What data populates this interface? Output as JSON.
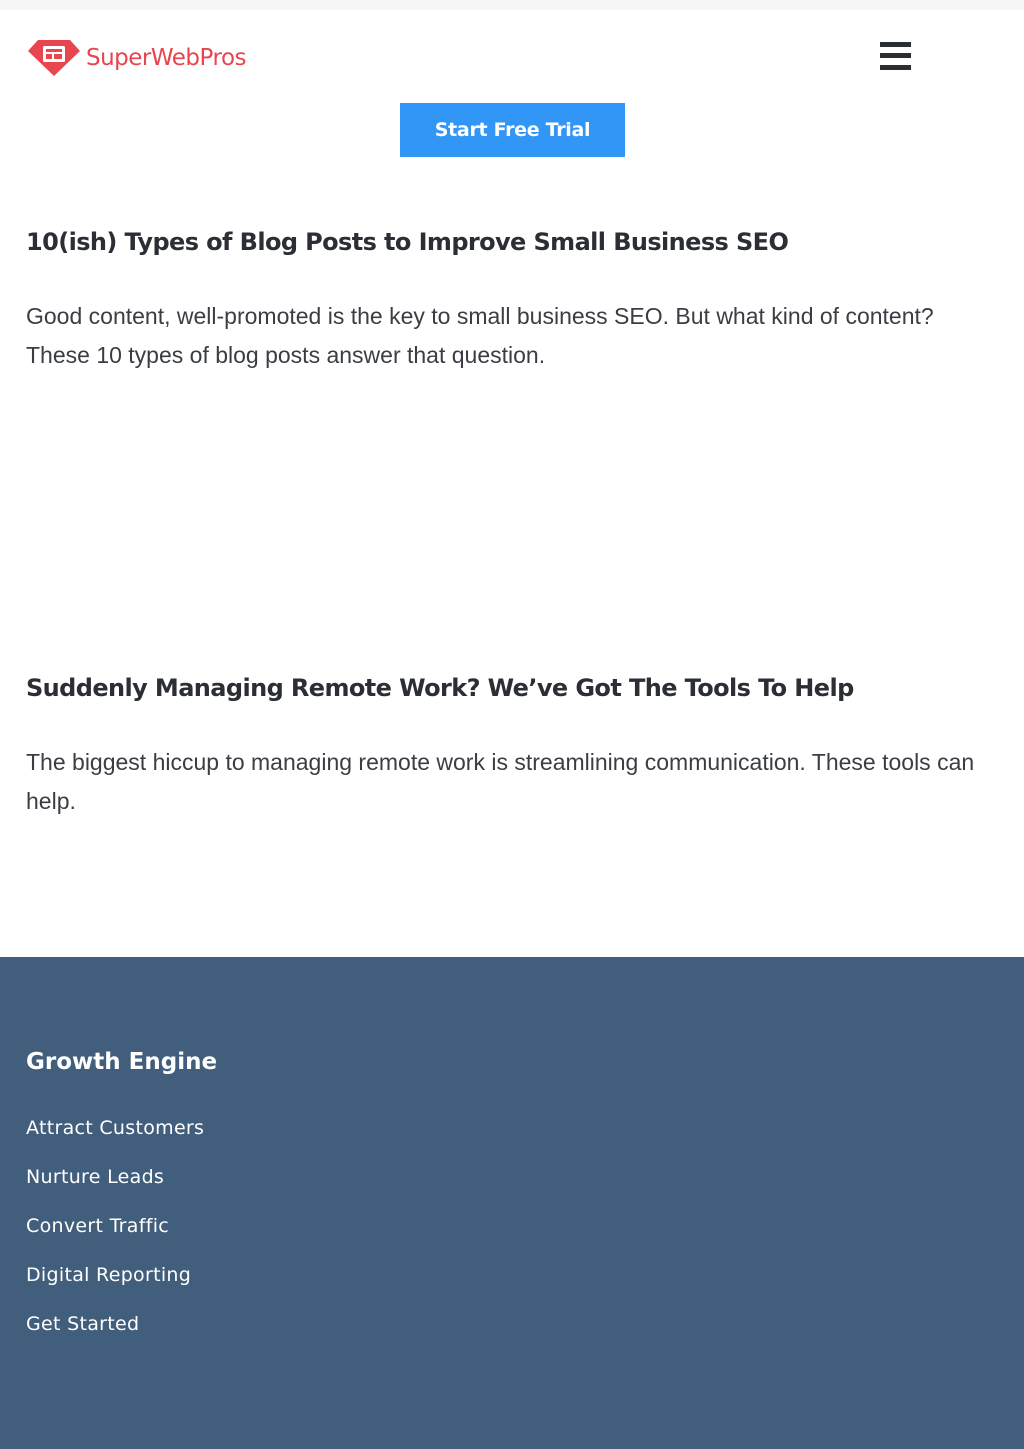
{
  "brand": {
    "name": "SuperWebPros",
    "logo_icon": "diamond-logo-icon",
    "accent": "#e8454f"
  },
  "header": {
    "menu_icon": "hamburger-menu-icon"
  },
  "cta": {
    "label": "Start Free Trial",
    "color": "#3296f7"
  },
  "posts": [
    {
      "title": "10(ish) Types of Blog Posts to Improve Small Business SEO",
      "excerpt": "Good content, well-promoted is the key to small business SEO. But what kind of content? These 10 types of blog posts answer that question."
    },
    {
      "title": "Suddenly Managing Remote Work? We’ve Got The Tools To Help",
      "excerpt": "The biggest hiccup to managing remote work is streamlining communication. These tools can help."
    }
  ],
  "footer": {
    "background": "#425e7d",
    "heading": "Growth Engine",
    "links": [
      "Attract Customers",
      "Nurture Leads",
      "Convert Traffic",
      "Digital Reporting",
      "Get Started"
    ]
  }
}
